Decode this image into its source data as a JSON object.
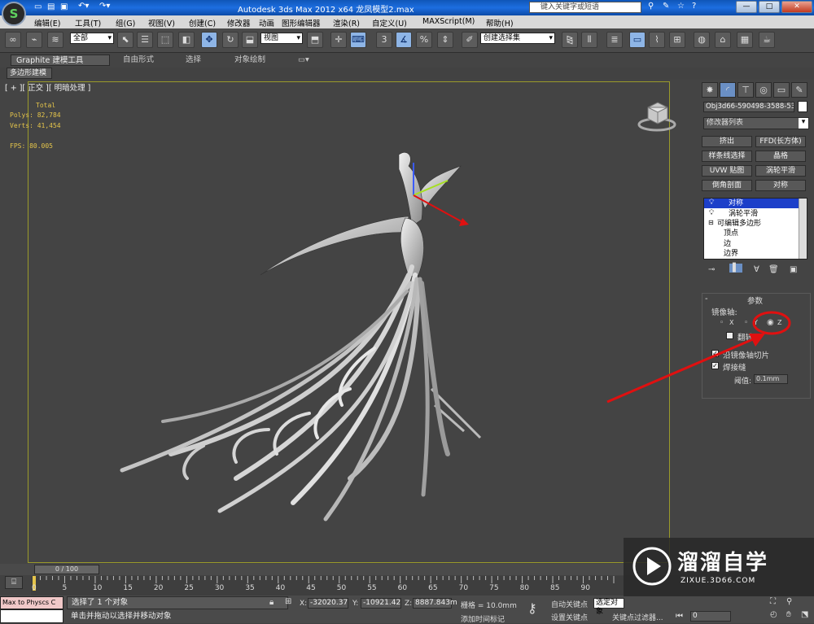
{
  "window": {
    "title": "Autodesk 3ds Max  2012 x64     龙凤模型2.max",
    "search_placeholder": "键入关键字或短语"
  },
  "menu": [
    "编辑(E)",
    "工具(T)",
    "组(G)",
    "视图(V)",
    "创建(C)",
    "修改器",
    "动画",
    "图形编辑器",
    "渲染(R)",
    "自定义(U)",
    "MAXScript(M)",
    "帮助(H)"
  ],
  "toolbar": {
    "filter": "全部",
    "refcoord": "视图",
    "selection_set": "创建选择集",
    "snap": "3",
    "percent_snap": "%"
  },
  "ribbon": {
    "tabs": [
      "Graphite 建模工具",
      "自由形式",
      "选择",
      "对象绘制"
    ],
    "subtab": "多边形建模"
  },
  "viewport": {
    "label": "[ + ][ 正交 ][ 明暗处理 ]",
    "stats": {
      "total": "Total",
      "polys": "Polys: 82,784",
      "verts": "Verts: 41,454",
      "fps": "FPS:   80.005"
    }
  },
  "timeline": {
    "slider": "0 / 100",
    "ticks": [
      "0",
      "5",
      "10",
      "15",
      "20",
      "25",
      "30",
      "35",
      "40",
      "45",
      "50",
      "55",
      "60",
      "65",
      "70",
      "75",
      "80",
      "85",
      "90"
    ]
  },
  "status": {
    "maxscript": "Max to Physcs C",
    "selected": "选择了 1 个对象",
    "prompt": "单击并拖动以选择并移动对象",
    "add_time_tag": "添加时间标记",
    "x": "-32020.37",
    "y": "-10921.42",
    "z": "8887.843m",
    "grid": "栅格 = 10.0mm",
    "autokey": "自动关键点",
    "setkey": "设置关键点",
    "selected_obj": "选定对象",
    "key_filters": "关键点过滤器...",
    "frame": "0"
  },
  "panel": {
    "object_name": "Obj3d66-590498-3588-538",
    "modifier_list": "修改器列表",
    "buttons": [
      "挤出",
      "FFD(长方体)",
      "样条线选择",
      "晶格",
      "UVW 贴图",
      "涡轮平滑",
      "倒角剖面",
      "对称"
    ],
    "stack": [
      "对称",
      "涡轮平滑",
      "可编辑多边形",
      "顶点",
      "边",
      "边界"
    ],
    "rollout": "参数",
    "mirror_axis_label": "镜像轴:",
    "axes": [
      "X",
      "Y",
      "Z"
    ],
    "flip": "翻转",
    "slice": "沿镜像轴切片",
    "weld": "焊接缝",
    "threshold_label": "阈值:",
    "threshold": "0.1mm"
  },
  "watermark": {
    "brand": "溜溜自学",
    "url": "ZIXUE.3D66.COM"
  },
  "colors": {
    "title_blue": "#1d6ee0",
    "viewport_bg": "#444444",
    "stats_yellow": "#e4c44b",
    "annotation_red": "#e01010",
    "stack_selected": "#1c3fc9"
  }
}
